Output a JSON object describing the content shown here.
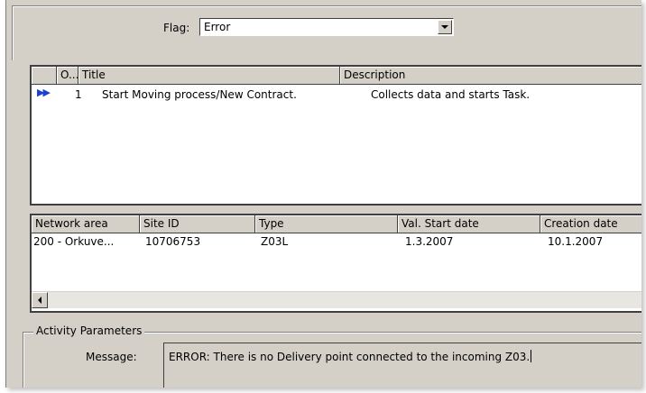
{
  "flag": {
    "label": "Flag:",
    "value": "Error"
  },
  "task_grid": {
    "columns": [
      "O...",
      "Title",
      "Description"
    ],
    "rows": [
      {
        "no": "1",
        "title": "Start Moving process/New Contract.",
        "description": "Collects data and starts Task."
      }
    ]
  },
  "site_grid": {
    "columns": [
      "Network area",
      "Site ID",
      "Type",
      "Val. Start date",
      "Creation date"
    ],
    "rows": [
      {
        "network_area": "200 - Orkuve...",
        "site_id": "10706753",
        "type": "Z03L",
        "val_start_date": "1.3.2007",
        "creation_date": "10.1.2007"
      }
    ]
  },
  "activity_parameters": {
    "title": "Activity Parameters",
    "message_label": "Message:",
    "message": "ERROR: There is no Delivery point connected to the incoming Z03."
  },
  "icons": {
    "row_indicator": "double-arrow-right-icon",
    "combo": "chevron-down-icon",
    "scroll": "arrow-left-icon"
  },
  "colors": {
    "indicator": "#1c3fd0",
    "panel": "#d4d0c8"
  }
}
